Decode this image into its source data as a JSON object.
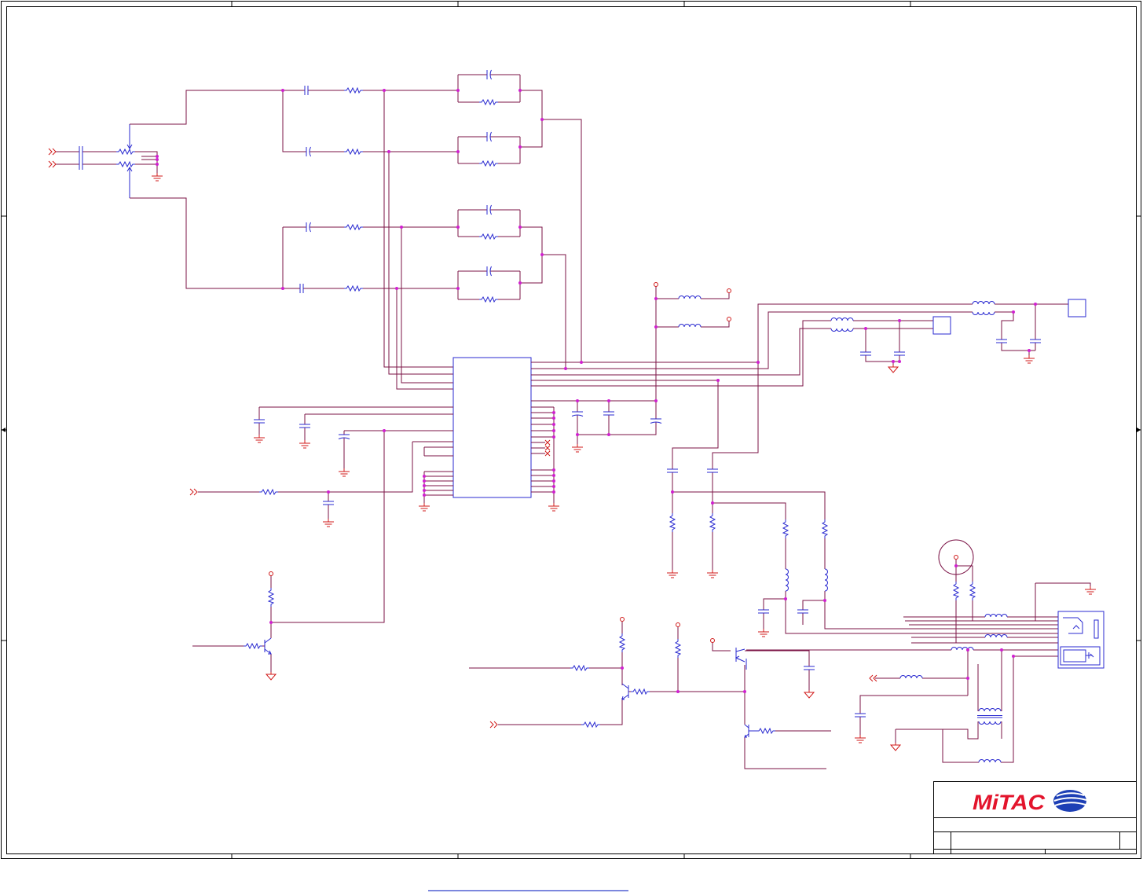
{
  "title_block": {
    "logo_text": "MiTAC"
  },
  "colors": {
    "wire": "#7b1346",
    "component": "#2a2ad0",
    "ground": "#d01818",
    "junction": "#d020d0",
    "logo_red": "#e3142c",
    "logo_blue": "#1d3fb5",
    "link": "#3344cc"
  },
  "icons": {
    "ground": "ground-icon",
    "offpage": "double-chevron-icon",
    "logo_globe": "globe-icon"
  }
}
